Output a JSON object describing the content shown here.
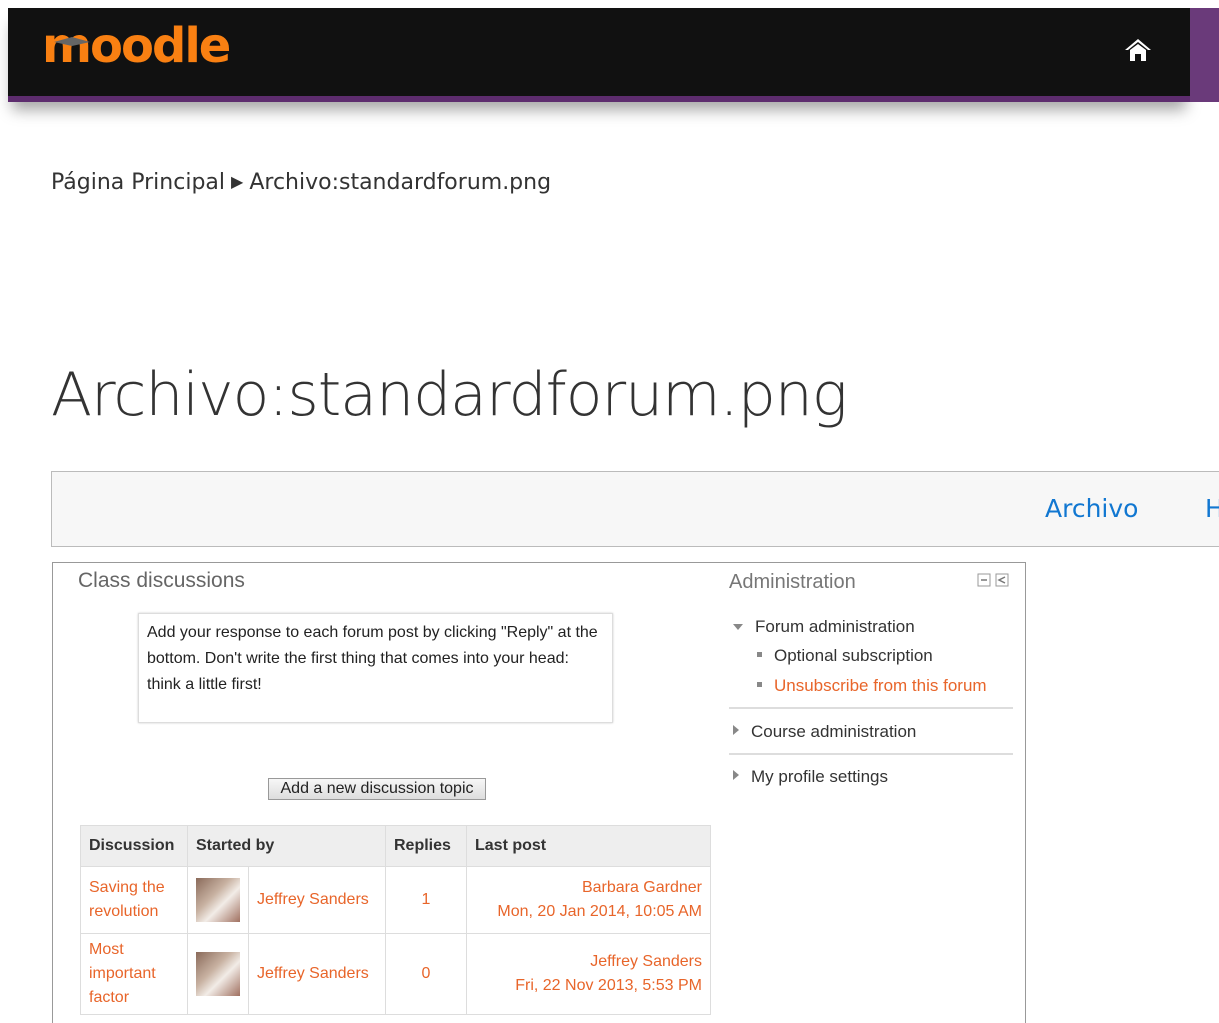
{
  "header": {
    "logo_text": "moodle",
    "brand_color": "#f98012",
    "bar_color": "#111111",
    "accent_color": "#5d2c6e",
    "home_icon": "home-icon"
  },
  "breadcrumb": {
    "home_label": "Página Principal",
    "separator": "▶",
    "current_label": "Archivo:standardforum.png"
  },
  "page": {
    "title": "Archivo:standardforum.png"
  },
  "tabs": {
    "archivo_label": "Archivo",
    "partial_label": "H",
    "link_color": "#1177d1"
  },
  "forum": {
    "title": "Class discussions",
    "intro": "Add your response to each forum post by clicking \"Reply\" at the bottom. Don't write the first thing that comes into your head: think a little first!",
    "add_button_label": "Add a new discussion topic",
    "link_color": "#e8652a",
    "columns": [
      "Discussion",
      "Started by",
      "Replies",
      "Last post"
    ],
    "rows": [
      {
        "discussion": "Saving the revolution",
        "started_by": "Jeffrey Sanders",
        "replies": "1",
        "last_post_author": "Barbara Gardner",
        "last_post_date": "Mon, 20 Jan 2014, 10:05 AM"
      },
      {
        "discussion": "Most important factor",
        "started_by": "Jeffrey Sanders",
        "replies": "0",
        "last_post_author": "Jeffrey Sanders",
        "last_post_date": "Fri, 22 Nov 2013, 5:53 PM"
      }
    ]
  },
  "administration": {
    "title": "Administration",
    "forum_admin_label": "Forum administration",
    "optional_subscription_label": "Optional subscription",
    "unsubscribe_label": "Unsubscribe from this forum",
    "course_admin_label": "Course administration",
    "profile_settings_label": "My profile settings"
  }
}
